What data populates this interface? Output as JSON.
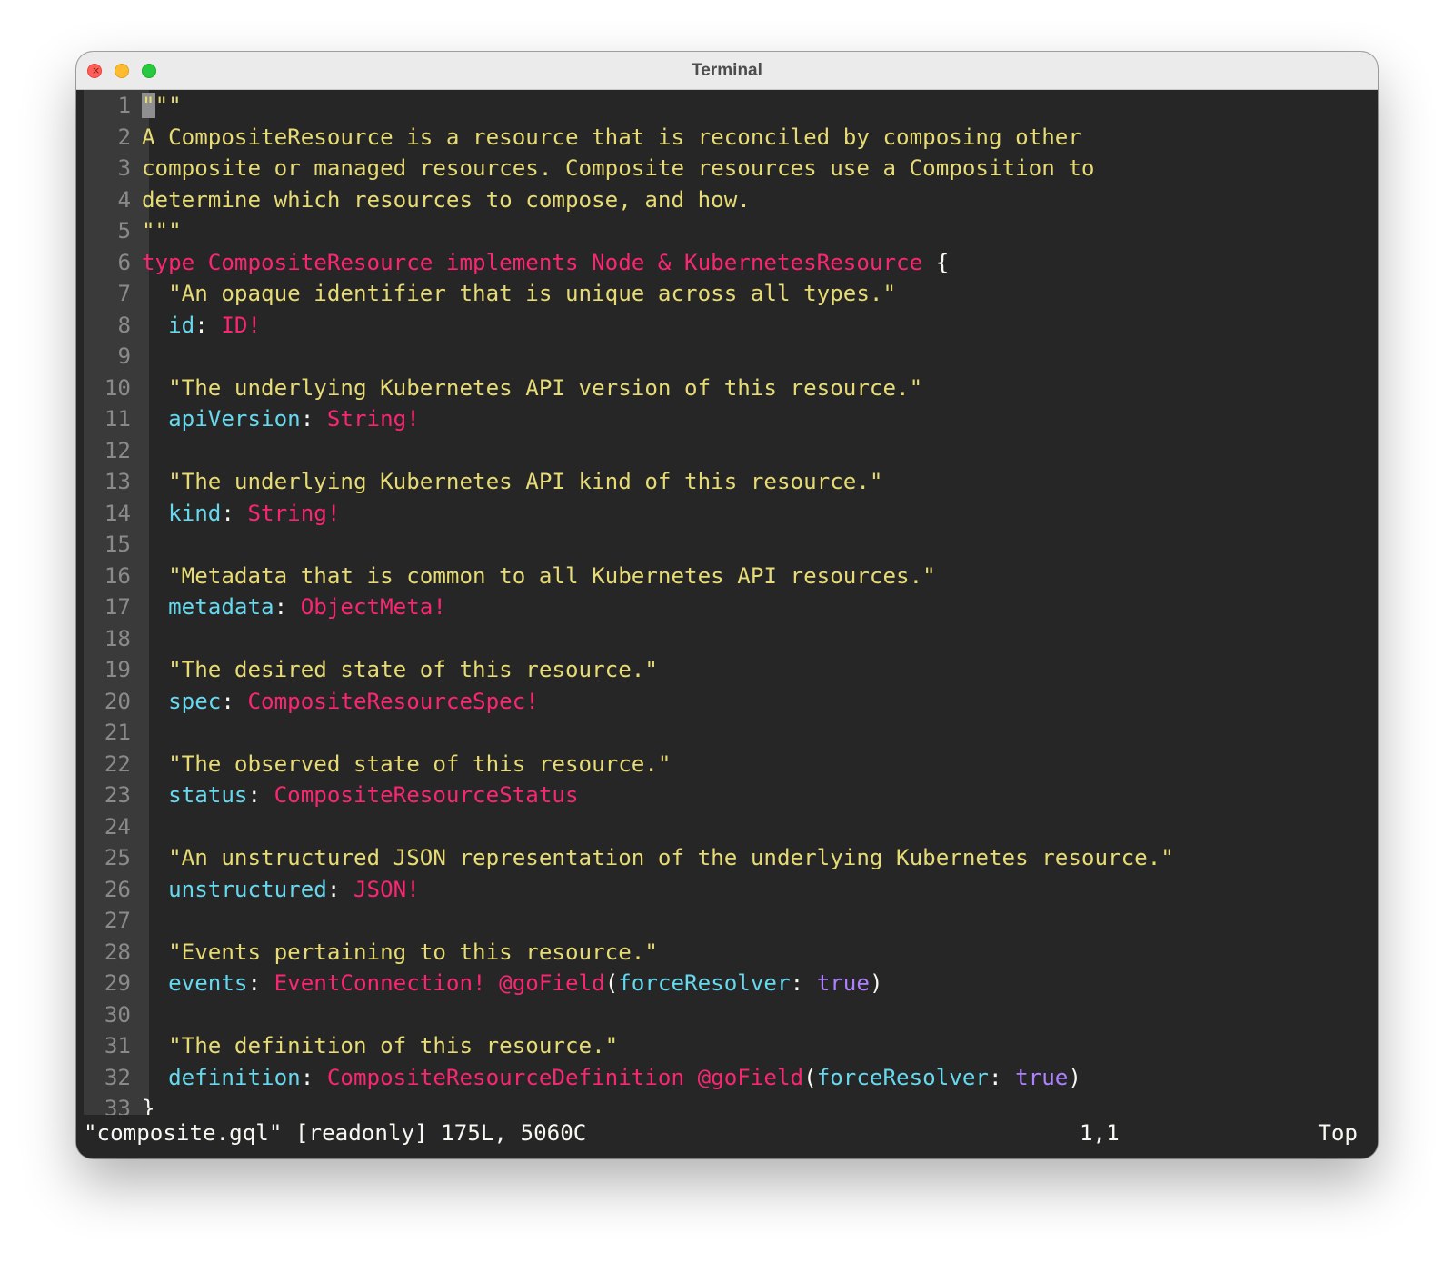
{
  "window": {
    "title": "Terminal",
    "close_glyph": "×"
  },
  "editor": {
    "lines": [
      {
        "n": "1",
        "t": [
          [
            "cursor",
            "\""
          ],
          [
            "str",
            "\"\""
          ]
        ]
      },
      {
        "n": "2",
        "t": [
          [
            "str",
            "A CompositeResource is a resource that is reconciled by composing other"
          ]
        ]
      },
      {
        "n": "3",
        "t": [
          [
            "str",
            "composite or managed resources. Composite resources use a Composition to"
          ]
        ]
      },
      {
        "n": "4",
        "t": [
          [
            "str",
            "determine which resources to compose, and how."
          ]
        ]
      },
      {
        "n": "5",
        "t": [
          [
            "str",
            "\"\"\""
          ]
        ]
      },
      {
        "n": "6",
        "t": [
          [
            "kw",
            "type CompositeResource implements Node & KubernetesResource"
          ],
          [
            "pn",
            " {"
          ]
        ]
      },
      {
        "n": "7",
        "t": [
          [
            "str",
            "  \"An opaque identifier that is unique across all types.\""
          ]
        ]
      },
      {
        "n": "8",
        "t": [
          [
            "pn",
            "  "
          ],
          [
            "fld",
            "id"
          ],
          [
            "pn",
            ": "
          ],
          [
            "tp",
            "ID!"
          ]
        ]
      },
      {
        "n": "9",
        "t": []
      },
      {
        "n": "10",
        "t": [
          [
            "str",
            "  \"The underlying Kubernetes API version of this resource.\""
          ]
        ]
      },
      {
        "n": "11",
        "t": [
          [
            "pn",
            "  "
          ],
          [
            "fld",
            "apiVersion"
          ],
          [
            "pn",
            ": "
          ],
          [
            "tp",
            "String!"
          ]
        ]
      },
      {
        "n": "12",
        "t": []
      },
      {
        "n": "13",
        "t": [
          [
            "str",
            "  \"The underlying Kubernetes API kind of this resource.\""
          ]
        ]
      },
      {
        "n": "14",
        "t": [
          [
            "pn",
            "  "
          ],
          [
            "fld",
            "kind"
          ],
          [
            "pn",
            ": "
          ],
          [
            "tp",
            "String!"
          ]
        ]
      },
      {
        "n": "15",
        "t": []
      },
      {
        "n": "16",
        "t": [
          [
            "str",
            "  \"Metadata that is common to all Kubernetes API resources.\""
          ]
        ]
      },
      {
        "n": "17",
        "t": [
          [
            "pn",
            "  "
          ],
          [
            "fld",
            "metadata"
          ],
          [
            "pn",
            ": "
          ],
          [
            "tp",
            "ObjectMeta!"
          ]
        ]
      },
      {
        "n": "18",
        "t": []
      },
      {
        "n": "19",
        "t": [
          [
            "str",
            "  \"The desired state of this resource.\""
          ]
        ]
      },
      {
        "n": "20",
        "t": [
          [
            "pn",
            "  "
          ],
          [
            "fld",
            "spec"
          ],
          [
            "pn",
            ": "
          ],
          [
            "tp",
            "CompositeResourceSpec!"
          ]
        ]
      },
      {
        "n": "21",
        "t": []
      },
      {
        "n": "22",
        "t": [
          [
            "str",
            "  \"The observed state of this resource.\""
          ]
        ]
      },
      {
        "n": "23",
        "t": [
          [
            "pn",
            "  "
          ],
          [
            "fld",
            "status"
          ],
          [
            "pn",
            ": "
          ],
          [
            "tp",
            "CompositeResourceStatus"
          ]
        ]
      },
      {
        "n": "24",
        "t": []
      },
      {
        "n": "25",
        "t": [
          [
            "str",
            "  \"An unstructured JSON representation of the underlying Kubernetes resource.\""
          ]
        ]
      },
      {
        "n": "26",
        "t": [
          [
            "pn",
            "  "
          ],
          [
            "fld",
            "unstructured"
          ],
          [
            "pn",
            ": "
          ],
          [
            "tp",
            "JSON!"
          ]
        ]
      },
      {
        "n": "27",
        "t": []
      },
      {
        "n": "28",
        "t": [
          [
            "str",
            "  \"Events pertaining to this resource.\""
          ]
        ]
      },
      {
        "n": "29",
        "t": [
          [
            "pn",
            "  "
          ],
          [
            "fld",
            "events"
          ],
          [
            "pn",
            ": "
          ],
          [
            "tp",
            "EventConnection! @goField"
          ],
          [
            "pn",
            "("
          ],
          [
            "fld",
            "forceResolver"
          ],
          [
            "pn",
            ": "
          ],
          [
            "bool",
            "true"
          ],
          [
            "pn",
            ")"
          ]
        ]
      },
      {
        "n": "30",
        "t": []
      },
      {
        "n": "31",
        "t": [
          [
            "str",
            "  \"The definition of this resource.\""
          ]
        ]
      },
      {
        "n": "32",
        "t": [
          [
            "pn",
            "  "
          ],
          [
            "fld",
            "definition"
          ],
          [
            "pn",
            ": "
          ],
          [
            "tp",
            "CompositeResourceDefinition @goField"
          ],
          [
            "pn",
            "("
          ],
          [
            "fld",
            "forceResolver"
          ],
          [
            "pn",
            ": "
          ],
          [
            "bool",
            "true"
          ],
          [
            "pn",
            ")"
          ]
        ]
      },
      {
        "n": "33",
        "t": [
          [
            "pn",
            "}"
          ]
        ]
      }
    ]
  },
  "statusbar": {
    "file_info": "\"composite.gql\" [readonly] 175L, 5060C",
    "cursor_position": "1,1",
    "scroll_position": "Top"
  },
  "colors": {
    "background": "#262626",
    "gutter": "#3a3a3a",
    "line_number": "#8a8a8a",
    "string": "#e6db74",
    "keyword_type": "#f92672",
    "field": "#66d9ef",
    "boolean": "#ae81ff",
    "punctuation": "#f8f8f2"
  }
}
